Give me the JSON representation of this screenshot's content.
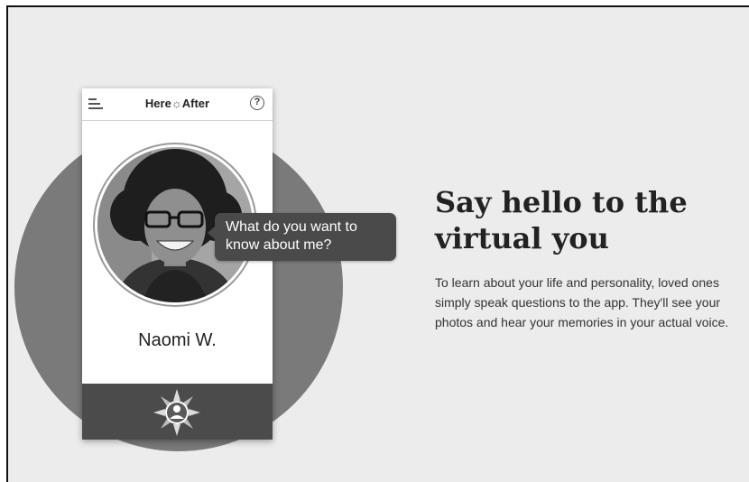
{
  "app": {
    "title_left": "Here",
    "title_right": "After",
    "menu_icon": "hamburger-icon",
    "help_icon": "help-icon",
    "help_symbol": "?",
    "logo_icon": "compass-icon"
  },
  "profile": {
    "name": "Naomi W.",
    "prompt": "What do you want to know about me?"
  },
  "hero": {
    "headline": "Say hello to the virtual you",
    "body": "To learn about your life and personality, loved ones simply speak questions to the app. They'll see your photos and hear your memories in your actual voice."
  },
  "colors": {
    "background": "#ececec",
    "circle": "#7a7a7a",
    "phone_footer": "#4b4b4b",
    "speech_bubble": "#4a4a4a"
  }
}
